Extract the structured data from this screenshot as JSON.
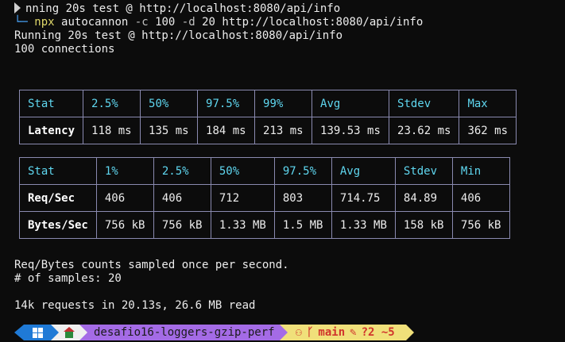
{
  "terminal": {
    "line1": "nning 20s test @ http://localhost:8080/api/info",
    "cmd_corner": "└─",
    "cmd_npx": "npx",
    "cmd_tool": "autocannon",
    "cmd_flag_c": "-c",
    "cmd_val_c": "100",
    "cmd_flag_d": "-d",
    "cmd_val_d": "20",
    "cmd_url": "http://localhost:8080/api/info",
    "line3": "Running 20s test @ http://localhost:8080/api/info",
    "line4": "100 connections",
    "note1": "Req/Bytes counts sampled once per second.",
    "note2": "# of samples: 20",
    "summary": "14k requests in 20.13s, 26.6 MB read"
  },
  "latency_table": {
    "headers": [
      "Stat",
      "2.5%",
      "50%",
      "97.5%",
      "99%",
      "Avg",
      "Stdev",
      "Max"
    ],
    "rows": [
      [
        "Latency",
        "118 ms",
        "135 ms",
        "184 ms",
        "213 ms",
        "139.53 ms",
        "23.62 ms",
        "362 ms"
      ]
    ]
  },
  "throughput_table": {
    "headers": [
      "Stat",
      "1%",
      "2.5%",
      "50%",
      "97.5%",
      "Avg",
      "Stdev",
      "Min"
    ],
    "rows": [
      [
        "Req/Sec",
        "406",
        "406",
        "712",
        "803",
        "714.75",
        "84.89",
        "406"
      ],
      [
        "Bytes/Sec",
        "756 kB",
        "756 kB",
        "1.33 MB",
        "1.5 MB",
        "1.33 MB",
        "158 kB",
        "756 kB"
      ]
    ]
  },
  "status_bar": {
    "icons": [
      "windows-icon",
      "home-icon",
      "github-icon",
      "branch-icon",
      "edit-icon"
    ],
    "path": "desafio16-loggers-gzip-perf",
    "branch": "main",
    "changes": "?2 ~5",
    "colors": {
      "windows_segment": "#1f7ad6",
      "home_segment": "#efefef",
      "path_segment": "#a46be6",
      "git_segment": "#f0e07a"
    }
  }
}
